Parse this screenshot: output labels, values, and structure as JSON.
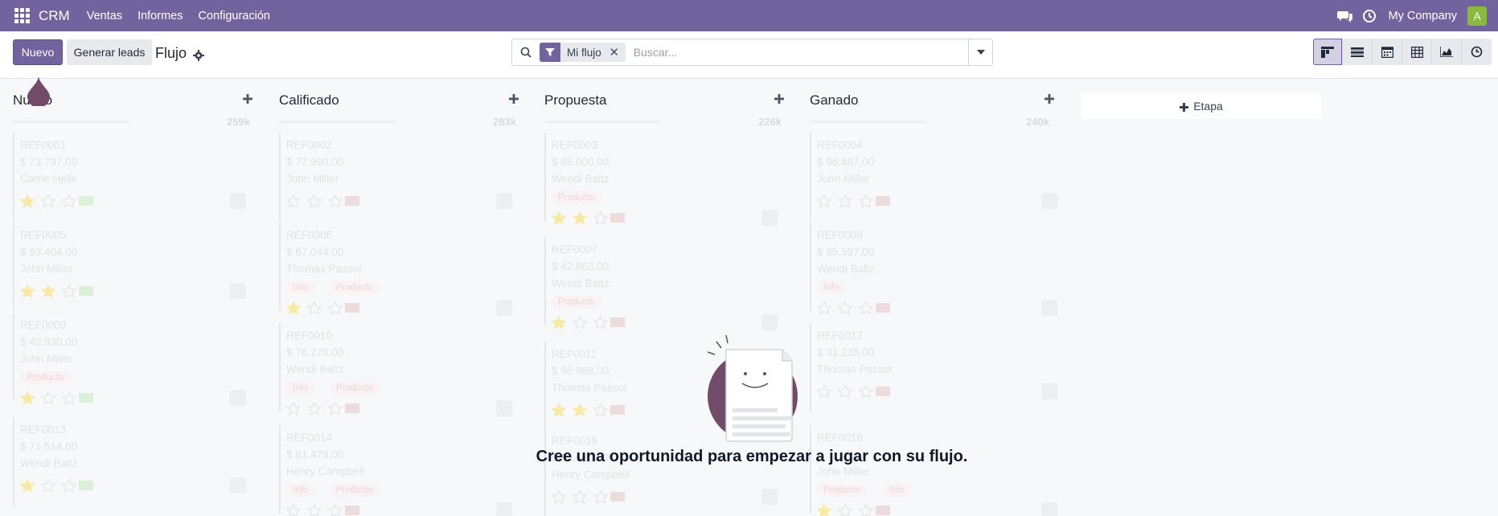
{
  "navbar": {
    "brand": "CRM",
    "menu": [
      "Ventas",
      "Informes",
      "Configuración"
    ],
    "company": "My Company",
    "avatar_initial": "A"
  },
  "control": {
    "new_label": "Nuevo",
    "generate_label": "Generar leads",
    "breadcrumb": "Flujo"
  },
  "search": {
    "facet": "Mi flujo",
    "placeholder": "Buscar..."
  },
  "views": [
    "kanban-icon",
    "list-icon",
    "calendar-icon",
    "pivot-icon",
    "graph-icon",
    "activity-icon"
  ],
  "columns": [
    {
      "title": "Nuevo",
      "total": "259k",
      "cards": [
        {
          "ref": "REF0001",
          "amount": "$ 73.797,00",
          "contact": "Carrie Helle",
          "tags": [],
          "stars": 1
        },
        {
          "ref": "REF0005",
          "amount": "$ 63.404,00",
          "contact": "John Miller",
          "tags": [],
          "stars": 2
        },
        {
          "ref": "REF0009",
          "amount": "$ 49.930,00",
          "contact": "John Miller",
          "tags": [
            "Producto"
          ],
          "stars": 1
        },
        {
          "ref": "REF0013",
          "amount": "$ 71.514,00",
          "contact": "Wendi Baltz",
          "tags": [],
          "stars": 1
        }
      ]
    },
    {
      "title": "Calificado",
      "total": "283k",
      "cards": [
        {
          "ref": "REF0002",
          "amount": "$ 77.990,00",
          "contact": "John Miller",
          "tags": [],
          "stars": 0
        },
        {
          "ref": "REF0006",
          "amount": "$ 67.044,00",
          "contact": "Thomas Passot",
          "tags": [
            "Info",
            "Producto"
          ],
          "stars": 1
        },
        {
          "ref": "REF0010",
          "amount": "$ 76.270,00",
          "contact": "Wendi Baltz",
          "tags": [
            "Info",
            "Producto"
          ],
          "stars": 0
        },
        {
          "ref": "REF0014",
          "amount": "$ 61.479,00",
          "contact": "Henry Campbell",
          "tags": [
            "Info",
            "Producto"
          ],
          "stars": 0
        }
      ]
    },
    {
      "title": "Propuesta",
      "total": "226k",
      "cards": [
        {
          "ref": "REF0003",
          "amount": "$ 68.000,00",
          "contact": "Wendi Baltz",
          "tags": [
            "Producto"
          ],
          "stars": 2
        },
        {
          "ref": "REF0007",
          "amount": "$ 42.863,00",
          "contact": "Wendi Baltz",
          "tags": [
            "Producto"
          ],
          "stars": 1
        },
        {
          "ref": "REF0011",
          "amount": "$ 96.968,00",
          "contact": "Thomas Passot",
          "tags": [],
          "stars": 2
        },
        {
          "ref": "REF0015",
          "amount": "$ 18.610,00",
          "contact": "Henry Campbell",
          "tags": [],
          "stars": 0
        }
      ]
    },
    {
      "title": "Ganado",
      "total": "240k",
      "cards": [
        {
          "ref": "REF0004",
          "amount": "$ 96.467,00",
          "contact": "John Miller",
          "tags": [],
          "stars": 0
        },
        {
          "ref": "REF0008",
          "amount": "$ 85.597,00",
          "contact": "Wendi Baltz",
          "tags": [
            "Info"
          ],
          "stars": 0
        },
        {
          "ref": "REF0012",
          "amount": "$ 31.235,00",
          "contact": "Thomas Passot",
          "tags": [],
          "stars": 0
        },
        {
          "ref": "REF0016",
          "amount": "",
          "contact": "John Miller",
          "tags": [
            "Producto",
            "Info"
          ],
          "stars": 1
        }
      ]
    }
  ],
  "add_stage_label": "Etapa",
  "helper_text": "Cree una oportunidad para empezar a jugar con su flujo.",
  "colors": {
    "primary": "#71639e",
    "avatar": "#8bb83f",
    "star": "#f3cc00"
  }
}
